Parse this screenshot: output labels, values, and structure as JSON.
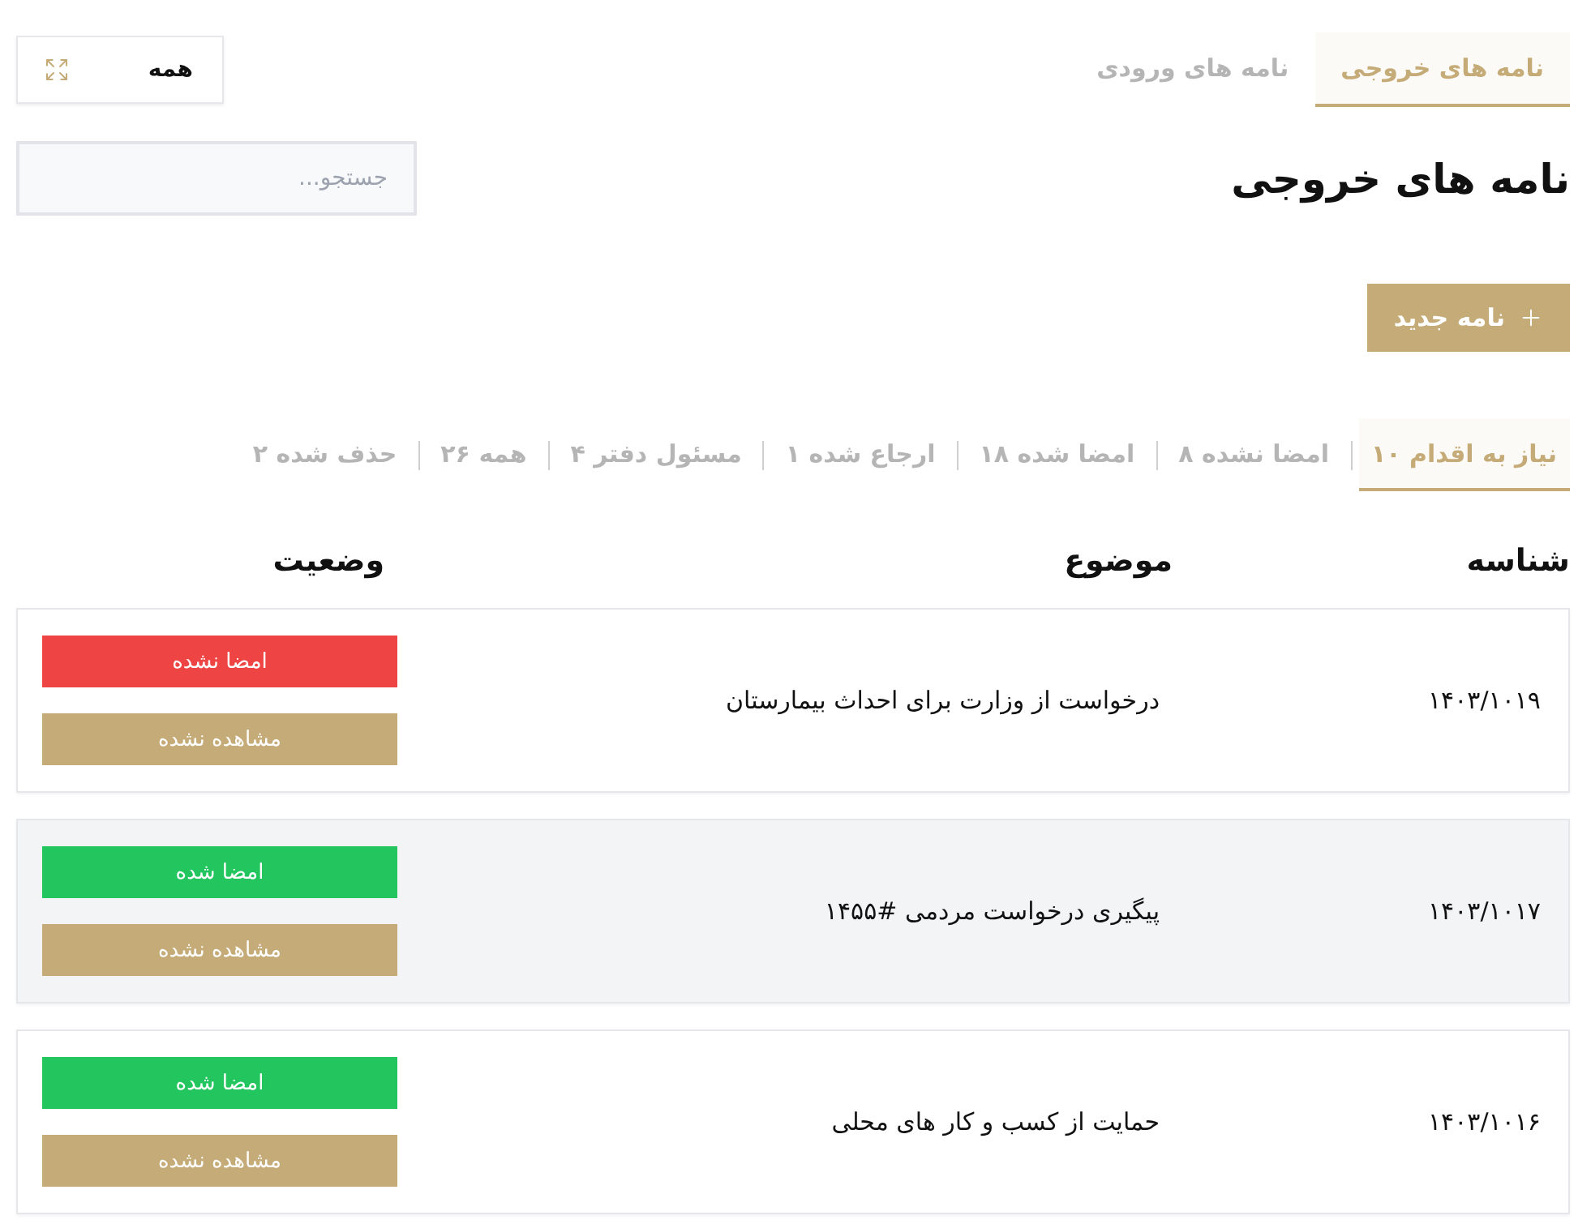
{
  "top_tabs": [
    {
      "label": "نامه های خروجی",
      "selected": true
    },
    {
      "label": "نامه های ورودی",
      "selected": false
    }
  ],
  "scope_button": {
    "label": "همه"
  },
  "page_title": "نامه های خروجی",
  "search": {
    "placeholder": "جستجو..."
  },
  "new_button": {
    "label": "نامه جدید"
  },
  "filters": [
    {
      "label": "نیاز به اقدام ۱۰",
      "selected": true
    },
    {
      "label": "امضا نشده ۸",
      "selected": false
    },
    {
      "label": "امضا شده ۱۸",
      "selected": false
    },
    {
      "label": "ارجاع شده ۱",
      "selected": false
    },
    {
      "label": "مسئول دفتر ۴",
      "selected": false
    },
    {
      "label": "همه ۲۶",
      "selected": false
    },
    {
      "label": "حذف شده ۲",
      "selected": false
    }
  ],
  "table": {
    "columns": [
      "شناسه",
      "موضوع",
      "وضعیت"
    ],
    "rows": [
      {
        "id": "۱۴۰۳/۱۰۱۹",
        "subject": "درخواست از وزارت برای احداث بیمارستان",
        "selected": false,
        "statuses": [
          {
            "label": "امضا نشده",
            "color": "#ef4444"
          },
          {
            "label": "مشاهده نشده",
            "color": "#c5ab78"
          }
        ]
      },
      {
        "id": "۱۴۰۳/۱۰۱۷",
        "subject": "پیگیری درخواست مردمی #۱۴۵۵",
        "selected": true,
        "statuses": [
          {
            "label": "امضا شده",
            "color": "#22c55e"
          },
          {
            "label": "مشاهده نشده",
            "color": "#c5ab78"
          }
        ]
      },
      {
        "id": "۱۴۰۳/۱۰۱۶",
        "subject": "حمایت از کسب و کار های محلی",
        "selected": false,
        "statuses": [
          {
            "label": "امضا شده",
            "color": "#22c55e"
          },
          {
            "label": "مشاهده نشده",
            "color": "#c5ab78"
          }
        ]
      }
    ]
  }
}
